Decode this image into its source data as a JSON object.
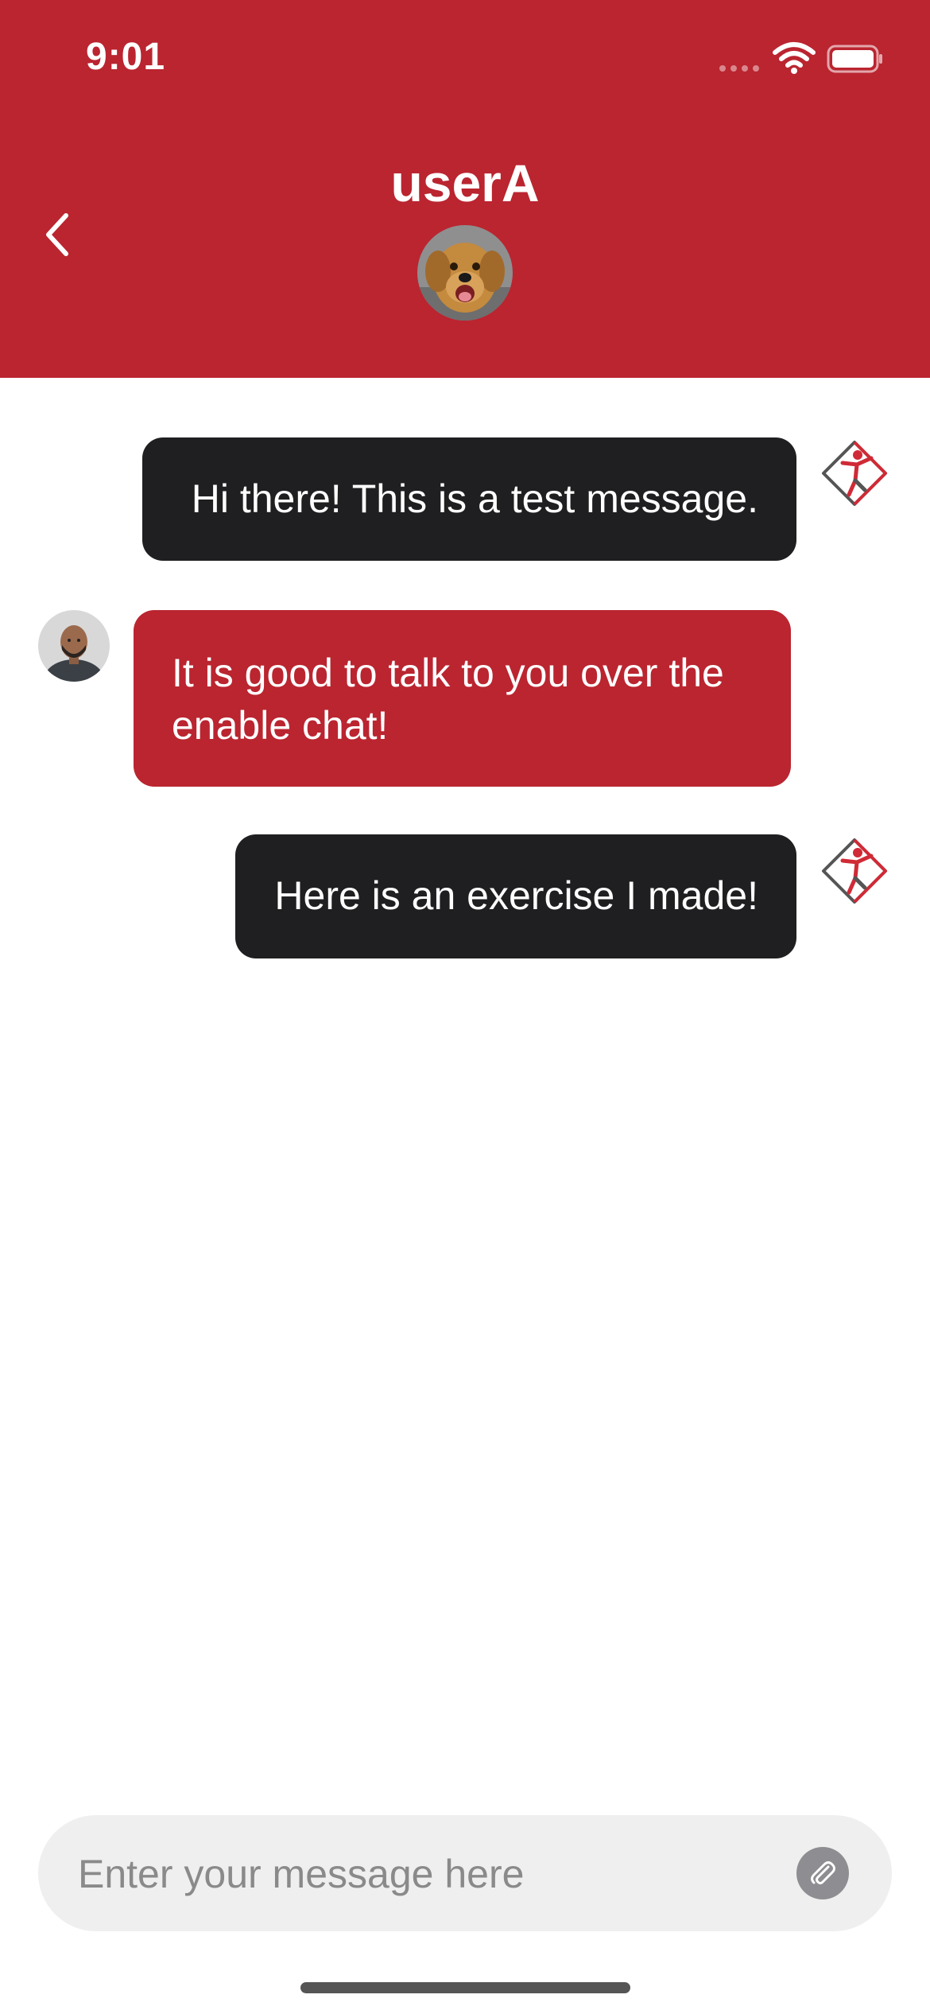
{
  "status_bar": {
    "time": "9:01"
  },
  "header": {
    "title": "userA",
    "avatar_icon": "dog-avatar-icon"
  },
  "messages": [
    {
      "sender": "self",
      "text": "Hi there! This is a test message."
    },
    {
      "sender": "other",
      "text": "It is good to talk to you over the enable chat!"
    },
    {
      "sender": "self",
      "text": "Here is an exercise I made!"
    }
  ],
  "composer": {
    "placeholder": "Enter your message here",
    "value": ""
  },
  "colors": {
    "brand": "#ba2530",
    "own_bubble": "#1f1f21",
    "input_bg": "#efefef"
  }
}
